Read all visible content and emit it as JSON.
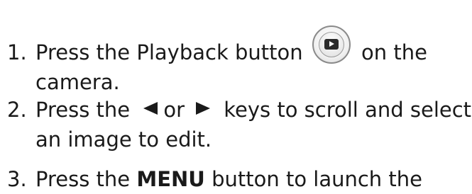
{
  "steps": [
    {
      "number": "1.",
      "text_before_icon": "Press the Playback button",
      "icon": "playback-button-icon",
      "text_after_icon": "on the",
      "line2": "camera."
    },
    {
      "number": "2.",
      "text_before": "Press the",
      "left_icon": "left-arrow-key-icon",
      "connector": "or",
      "right_icon": "right-arrow-key-icon",
      "text_after": "keys to scroll and select",
      "line2": "an image to edit."
    },
    {
      "number": "3.",
      "text_before": "Press the",
      "bold_word": "MENU",
      "text_after": "button to launch the"
    }
  ]
}
